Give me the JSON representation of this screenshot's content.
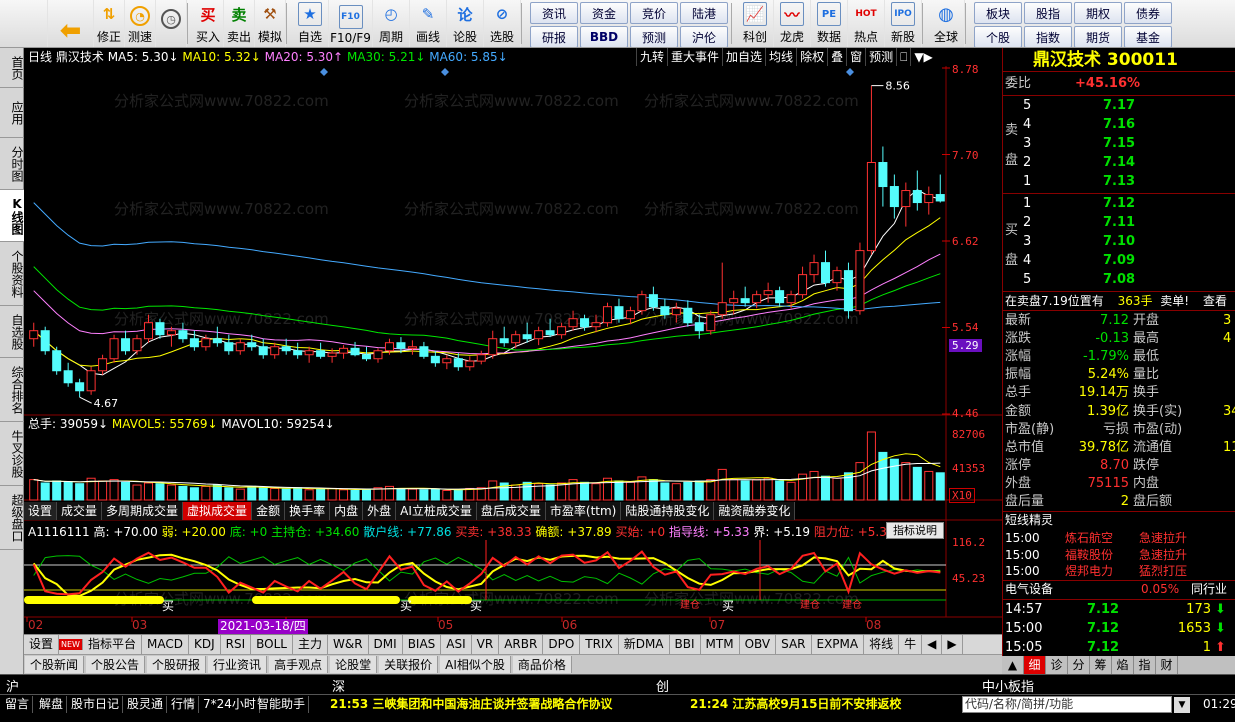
{
  "toolbar": {
    "buttons": [
      {
        "label": "",
        "icon": "windows-logo-icon"
      },
      {
        "label": "",
        "icon": "back-arrow-icon"
      },
      {
        "label": "修正",
        "icon": "adjust-icon"
      },
      {
        "label": "测速",
        "icon": "speed-clock-icon"
      },
      {
        "label": "买入",
        "icon": "buy-icon"
      },
      {
        "label": "卖出",
        "icon": "sell-icon"
      },
      {
        "label": "模拟",
        "icon": "hammer-icon"
      },
      {
        "label": "自选",
        "icon": "star-icon"
      },
      {
        "label": "F10/F9",
        "icon": "f10-icon"
      },
      {
        "label": "周期",
        "icon": "clock-icon"
      },
      {
        "label": "画线",
        "icon": "pencil-icon"
      },
      {
        "label": "论股",
        "icon": "discuss-icon"
      },
      {
        "label": "选股",
        "icon": "select-stock-icon"
      }
    ],
    "nav1": [
      "资讯",
      "资金",
      "竞价",
      "陆港",
      "研报",
      "BBD",
      "预测",
      "沪伦"
    ],
    "icons2": [
      {
        "label": "科创",
        "icon": "kechuang-icon"
      },
      {
        "label": "龙虎",
        "icon": "dragon-tiger-icon"
      },
      {
        "label": "数据",
        "icon": "data-icon"
      },
      {
        "label": "热点",
        "icon": "hot-icon"
      },
      {
        "label": "新股",
        "icon": "ipo-icon"
      },
      {
        "label": "全球",
        "icon": "globe-icon"
      }
    ],
    "nav2": [
      "板块",
      "股指",
      "期权",
      "债券",
      "个股",
      "指数",
      "期货",
      "基金"
    ],
    "icon_labels": {
      "buy": "买",
      "sell": "卖",
      "f10": "F10",
      "pe": "PE",
      "lun": "论",
      "ipo": "IPO",
      "hot": "HOT"
    }
  },
  "left_tabs": [
    {
      "label": "首页",
      "active": false
    },
    {
      "label": "应用",
      "active": false
    },
    {
      "label": "分时图",
      "active": false
    },
    {
      "label": "K线图",
      "active": true
    },
    {
      "label": "个股资料",
      "active": false
    },
    {
      "label": "自选股",
      "active": false
    },
    {
      "label": "综合排名",
      "active": false
    },
    {
      "label": "牛叉诊股",
      "active": false
    },
    {
      "label": "超级盘口",
      "active": false
    }
  ],
  "main_header": {
    "period": "日线",
    "name": "鼎汉技术",
    "ma5": "MA5: 5.30↓",
    "ma10": "MA10: 5.32↓",
    "ma20": "MA20: 5.30↑",
    "ma30": "MA30: 5.21↓",
    "ma60": "MA60: 5.85↓"
  },
  "right_buttons": [
    "九转",
    "重大事件",
    "加自选",
    "均线",
    "除权",
    "叠",
    "窗",
    "预测",
    "⎕",
    "▼▶"
  ],
  "price_axis": [
    "8.78",
    "7.70",
    "6.62",
    "5.54",
    "5.29",
    "4.46"
  ],
  "high_label": "8.56",
  "low_label": "4.67",
  "volume_header": {
    "total": "总手: 39059↓",
    "mavol5": "MAVOL5: 55769↓",
    "mavol10": "MAVOL10: 59254↓"
  },
  "volume_axis": [
    "82706",
    "41353",
    "X10"
  ],
  "subtabs": [
    "设置",
    "成交量",
    "多周期成交量",
    "虚拟成交量",
    "金额",
    "换手率",
    "内盘",
    "外盘",
    "AI立桩成交量",
    "盘后成交量",
    "市盈率(ttm)",
    "陆股通持股变化",
    "融资融券变化"
  ],
  "indicator_header": {
    "name": "A1116111",
    "high": "高: +70.00",
    "weak": "弱: +20.00",
    "bottom": "底: +0",
    "main": "主持仓: +34.60",
    "retail": "散户线: +77.86",
    "buysell": "买卖: +38.33",
    "confirm": "确额: +37.89",
    "buystart": "买始: +0",
    "guide": "指导线: +5.33",
    "boundary": "界: +5.19",
    "resistance": "阻力位: +5.32"
  },
  "indicator_button": "指标说明",
  "indicator_axis": [
    "116.2",
    "45.23"
  ],
  "signals": [
    "买",
    "买",
    "买",
    "买",
    "建仓",
    "建仓",
    "建仓"
  ],
  "dates": [
    "02",
    "03",
    "04",
    "05",
    "06",
    "07",
    "08"
  ],
  "date_highlight": "2021-03-18/四",
  "indicator_tabs": [
    "设置",
    "NEW",
    "指标平台",
    "MACD",
    "KDJ",
    "RSI",
    "BOLL",
    "主力",
    "W&R",
    "DMI",
    "BIAS",
    "ASI",
    "VR",
    "ARBR",
    "DPO",
    "TRIX",
    "新DMA",
    "BBI",
    "MTM",
    "OBV",
    "SAR",
    "EXPMA",
    "将线",
    "牛"
  ],
  "info_tabs": [
    "个股新闻",
    "个股公告",
    "个股研报",
    "行业资讯",
    "高手观点",
    "论股堂",
    "关联报价",
    "AI相似个股",
    "商品价格"
  ],
  "quote": {
    "name": "鼎汉技术",
    "code": "300011",
    "weibi_label": "委比",
    "weibi": "+45.16%",
    "sell_label": "卖盘",
    "buy_label": "买盘",
    "asks": [
      {
        "lvl": "5",
        "price": "7.17"
      },
      {
        "lvl": "4",
        "price": "7.16"
      },
      {
        "lvl": "3",
        "price": "7.15"
      },
      {
        "lvl": "2",
        "price": "7.14"
      },
      {
        "lvl": "1",
        "price": "7.13"
      }
    ],
    "bids": [
      {
        "lvl": "1",
        "price": "7.12"
      },
      {
        "lvl": "2",
        "price": "7.11"
      },
      {
        "lvl": "3",
        "price": "7.10"
      },
      {
        "lvl": "4",
        "price": "7.09"
      },
      {
        "lvl": "5",
        "price": "7.08"
      }
    ],
    "sell_order": "在卖盘7.19位置有",
    "sell_order_vol": "363手",
    "sell_order_tail": "卖单!",
    "check": "查看",
    "stats": [
      {
        "l": "最新",
        "v": "7.12",
        "vc": "green",
        "l2": "开盘"
      },
      {
        "l": "涨跌",
        "v": "-0.13",
        "vc": "green",
        "l2": "最高"
      },
      {
        "l": "涨幅",
        "v": "-1.79%",
        "vc": "green",
        "l2": "最低"
      },
      {
        "l": "振幅",
        "v": "5.24%",
        "vc": "yellow",
        "l2": "量比"
      },
      {
        "l": "总手",
        "v": "19.14万",
        "vc": "yellow",
        "l2": "换手"
      },
      {
        "l": "金额",
        "v": "1.39亿",
        "vc": "yellow",
        "l2": "换手(实)"
      },
      {
        "l": "市盈(静)",
        "v": "亏损",
        "vc": "gray",
        "l2": "市盈(动)"
      },
      {
        "l": "总市值",
        "v": "39.78亿",
        "vc": "yellow",
        "l2": "流通值"
      },
      {
        "l": "涨停",
        "v": "8.70",
        "vc": "red",
        "l2": "跌停"
      },
      {
        "l": "外盘",
        "v": "75115",
        "vc": "red",
        "l2": "内盘"
      },
      {
        "l": "盘后量",
        "v": "2",
        "vc": "yellow",
        "l2": "盘后额"
      }
    ],
    "stats_right": [
      "3",
      "4",
      "",
      "",
      "",
      "34.",
      "",
      "11."
    ],
    "short_title": "短线精灵",
    "short_items": [
      {
        "time": "15:00",
        "name": "炼石航空",
        "event": "急速拉升"
      },
      {
        "time": "15:00",
        "name": "福鞍股份",
        "event": "急速拉升"
      },
      {
        "time": "15:00",
        "name": "煜邦电力",
        "event": "猛烈打压"
      }
    ],
    "sector": "电气设备",
    "sector_pct": "0.05%",
    "sector_tail": "同行业",
    "ticks": [
      {
        "time": "14:57",
        "price": "7.12",
        "vol": "173",
        "dir": "down"
      },
      {
        "time": "15:00",
        "price": "7.12",
        "vol": "1653",
        "dir": "down"
      },
      {
        "time": "15:05",
        "price": "7.12",
        "vol": "1",
        "dir": "up"
      }
    ],
    "rtabs": [
      "细",
      "诊",
      "分",
      "筹",
      "焰",
      "指",
      "财"
    ]
  },
  "exchange_bar": [
    "沪",
    "深",
    "创",
    "中小板指"
  ],
  "status_bar": [
    "留言",
    "解盘",
    "股市日记",
    "股灵通",
    "行情",
    "7*24小时",
    "智能助手"
  ],
  "news": [
    "21:53 三峡集团和中国海油庄谈并签署战略合作协议",
    "21:24 江苏高校9月15日前不安排返校"
  ],
  "search_placeholder": "代码/名称/简拼/功能",
  "clock": "01:29",
  "watermark": "分析家公式网www.70822.com",
  "chart_data": {
    "type": "candlestick",
    "price_range": [
      4.46,
      8.78
    ],
    "candles": [
      [
        5.4,
        5.6,
        5.3,
        5.5
      ],
      [
        5.5,
        5.55,
        5.2,
        5.25
      ],
      [
        5.25,
        5.3,
        4.95,
        5.0
      ],
      [
        5.0,
        5.1,
        4.8,
        4.85
      ],
      [
        4.85,
        4.9,
        4.67,
        4.75
      ],
      [
        4.75,
        5.05,
        4.7,
        5.0
      ],
      [
        5.0,
        5.2,
        4.95,
        5.15
      ],
      [
        5.15,
        5.45,
        5.1,
        5.4
      ],
      [
        5.4,
        5.5,
        5.2,
        5.25
      ],
      [
        5.25,
        5.45,
        5.2,
        5.4
      ],
      [
        5.4,
        5.7,
        5.35,
        5.6
      ],
      [
        5.6,
        5.65,
        5.4,
        5.45
      ],
      [
        5.45,
        5.55,
        5.3,
        5.5
      ],
      [
        5.5,
        5.6,
        5.35,
        5.4
      ],
      [
        5.4,
        5.5,
        5.25,
        5.3
      ],
      [
        5.3,
        5.45,
        5.25,
        5.4
      ],
      [
        5.4,
        5.55,
        5.3,
        5.35
      ],
      [
        5.35,
        5.45,
        5.2,
        5.25
      ],
      [
        5.25,
        5.4,
        5.2,
        5.35
      ],
      [
        5.35,
        5.45,
        5.25,
        5.3
      ],
      [
        5.3,
        5.4,
        5.15,
        5.2
      ],
      [
        5.2,
        5.35,
        5.15,
        5.3
      ],
      [
        5.3,
        5.4,
        5.2,
        5.25
      ],
      [
        5.25,
        5.35,
        5.15,
        5.2
      ],
      [
        5.2,
        5.3,
        5.1,
        5.25
      ],
      [
        5.25,
        5.35,
        5.15,
        5.18
      ],
      [
        5.18,
        5.28,
        5.1,
        5.22
      ],
      [
        5.22,
        5.32,
        5.15,
        5.28
      ],
      [
        5.28,
        5.36,
        5.18,
        5.2
      ],
      [
        5.2,
        5.3,
        5.12,
        5.15
      ],
      [
        5.15,
        5.28,
        5.1,
        5.25
      ],
      [
        5.25,
        5.4,
        5.2,
        5.35
      ],
      [
        5.35,
        5.42,
        5.22,
        5.28
      ],
      [
        5.28,
        5.38,
        5.2,
        5.3
      ],
      [
        5.3,
        5.36,
        5.15,
        5.18
      ],
      [
        5.18,
        5.25,
        5.05,
        5.1
      ],
      [
        5.1,
        5.2,
        5.02,
        5.15
      ],
      [
        5.15,
        5.22,
        5.0,
        5.05
      ],
      [
        5.05,
        5.18,
        5.0,
        5.12
      ],
      [
        5.12,
        5.25,
        5.08,
        5.2
      ],
      [
        5.2,
        5.5,
        5.15,
        5.4
      ],
      [
        5.4,
        5.55,
        5.3,
        5.35
      ],
      [
        5.35,
        5.5,
        5.28,
        5.45
      ],
      [
        5.45,
        5.6,
        5.35,
        5.4
      ],
      [
        5.4,
        5.55,
        5.32,
        5.5
      ],
      [
        5.5,
        5.65,
        5.42,
        5.45
      ],
      [
        5.45,
        5.6,
        5.4,
        5.55
      ],
      [
        5.55,
        5.75,
        5.5,
        5.65
      ],
      [
        5.65,
        5.7,
        5.5,
        5.55
      ],
      [
        5.55,
        5.7,
        5.48,
        5.6
      ],
      [
        5.6,
        5.85,
        5.55,
        5.8
      ],
      [
        5.8,
        5.9,
        5.6,
        5.65
      ],
      [
        5.65,
        5.8,
        5.58,
        5.75
      ],
      [
        5.75,
        6.0,
        5.7,
        5.95
      ],
      [
        5.95,
        6.05,
        5.75,
        5.8
      ],
      [
        5.8,
        5.9,
        5.65,
        5.7
      ],
      [
        5.7,
        5.85,
        5.6,
        5.78
      ],
      [
        5.78,
        5.88,
        5.55,
        5.6
      ],
      [
        5.6,
        5.7,
        5.4,
        5.5
      ],
      [
        5.5,
        5.75,
        5.45,
        5.7
      ],
      [
        5.7,
        6.35,
        5.65,
        5.85
      ],
      [
        5.85,
        6.0,
        5.7,
        5.9
      ],
      [
        5.9,
        6.05,
        5.8,
        5.85
      ],
      [
        5.85,
        6.0,
        5.78,
        5.95
      ],
      [
        5.95,
        6.1,
        5.85,
        6.0
      ],
      [
        6.0,
        6.05,
        5.8,
        5.85
      ],
      [
        5.85,
        6.0,
        5.78,
        5.95
      ],
      [
        5.95,
        6.3,
        5.9,
        6.2
      ],
      [
        6.2,
        6.45,
        6.1,
        6.35
      ],
      [
        6.35,
        6.5,
        6.05,
        6.1
      ],
      [
        6.1,
        6.3,
        6.0,
        6.25
      ],
      [
        6.25,
        6.35,
        5.65,
        5.75
      ],
      [
        5.75,
        6.6,
        5.7,
        6.5
      ],
      [
        6.5,
        8.56,
        6.45,
        7.6
      ],
      [
        7.6,
        7.8,
        7.05,
        7.3
      ],
      [
        7.3,
        7.45,
        6.9,
        7.05
      ],
      [
        7.05,
        7.35,
        6.8,
        7.25
      ],
      [
        7.25,
        7.5,
        7.0,
        7.1
      ],
      [
        7.1,
        7.3,
        6.95,
        7.2
      ],
      [
        7.2,
        7.45,
        7.1,
        7.12
      ]
    ],
    "volumes": [
      30,
      25,
      28,
      26,
      24,
      32,
      28,
      30,
      26,
      22,
      25,
      24,
      22,
      20,
      18,
      20,
      22,
      18,
      16,
      20,
      18,
      17,
      16,
      18,
      15,
      16,
      17,
      15,
      14,
      16,
      18,
      20,
      17,
      16,
      15,
      16,
      14,
      15,
      17,
      18,
      28,
      25,
      22,
      26,
      24,
      22,
      25,
      30,
      26,
      24,
      32,
      28,
      26,
      34,
      30,
      25,
      24,
      26,
      28,
      30,
      45,
      30,
      28,
      30,
      32,
      28,
      26,
      38,
      42,
      35,
      32,
      40,
      55,
      100,
      70,
      60,
      55,
      48,
      42,
      40
    ],
    "ma_labels": [
      "MA5",
      "MA10",
      "MA20",
      "MA30",
      "MA60"
    ],
    "colors": {
      "up": "#ff3232",
      "down": "#54fcfc",
      "ma5": "#ffffff",
      "ma10": "#ffff00",
      "ma20": "#ff80ff",
      "ma30": "#00e600",
      "ma60": "#44aaff"
    }
  }
}
